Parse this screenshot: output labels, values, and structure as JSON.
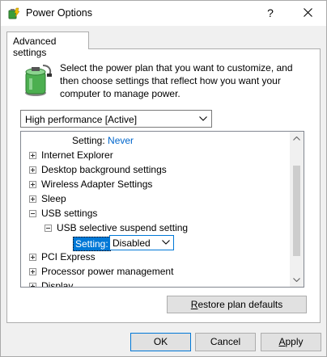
{
  "window": {
    "title": "Power Options",
    "help_glyph": "?"
  },
  "tab": {
    "label": "Advanced settings"
  },
  "intro": {
    "line1": "Select the power plan that you want to customize, and",
    "line2": "then choose settings that reflect how you want your",
    "line3": "computer to manage power."
  },
  "plan_select": {
    "value": "High performance [Active]"
  },
  "tree": {
    "top_setting_label": "Setting:",
    "top_setting_value": "Never",
    "items": [
      {
        "label": "Internet Explorer"
      },
      {
        "label": "Desktop background settings"
      },
      {
        "label": "Wireless Adapter Settings"
      },
      {
        "label": "Sleep"
      },
      {
        "label": "USB settings"
      },
      {
        "label": "USB selective suspend setting"
      },
      {
        "label": "PCI Express"
      },
      {
        "label": "Processor power management"
      },
      {
        "label": "Display"
      }
    ],
    "usb_setting_label": "Setting:",
    "usb_setting_value": "Disabled"
  },
  "buttons": {
    "restore_prefix": "R",
    "restore_rest": "estore plan defaults",
    "ok": "OK",
    "cancel": "Cancel",
    "apply_prefix": "A",
    "apply_rest": "pply"
  }
}
